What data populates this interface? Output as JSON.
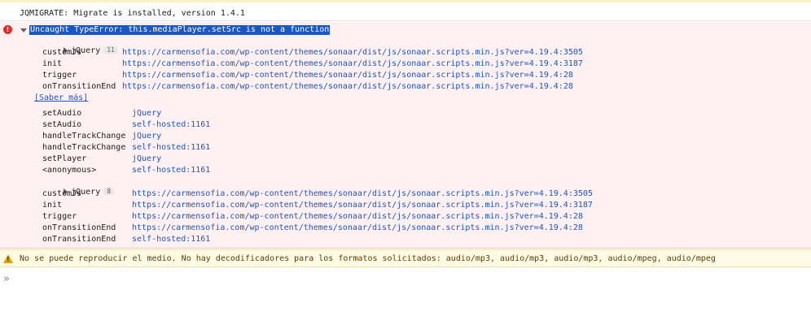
{
  "console": {
    "log_message": "JQMIGRATE: Migrate is installed, version 1.4.1",
    "error": {
      "icon": "error-circle-icon",
      "message": "Uncaught TypeError: this.mediaPlayer.setSrc is not a function",
      "group1": {
        "label": "jQuery",
        "count": "11"
      },
      "frames1": [
        {
          "fn": "customJs",
          "loc": "https://carmensofia.com/wp-content/themes/sonaar/dist/js/sonaar.scripts.min.js?ver=4.19.4:3505"
        },
        {
          "fn": "init",
          "loc": "https://carmensofia.com/wp-content/themes/sonaar/dist/js/sonaar.scripts.min.js?ver=4.19.4:3187"
        },
        {
          "fn": "trigger",
          "loc": "https://carmensofia.com/wp-content/themes/sonaar/dist/js/sonaar.scripts.min.js?ver=4.19.4:28"
        },
        {
          "fn": "onTransitionEnd",
          "loc": "https://carmensofia.com/wp-content/themes/sonaar/dist/js/sonaar.scripts.min.js?ver=4.19.4:28"
        }
      ],
      "learn_more": "[Saber más]",
      "frames2": [
        {
          "fn": "setAudio",
          "loc": "jQuery"
        },
        {
          "fn": "setAudio",
          "loc": "self-hosted:1161"
        },
        {
          "fn": "handleTrackChange",
          "loc": "jQuery"
        },
        {
          "fn": "handleTrackChange",
          "loc": "self-hosted:1161"
        },
        {
          "fn": "setPlayer",
          "loc": "jQuery"
        },
        {
          "fn": "<anonymous>",
          "loc": "self-hosted:1161"
        }
      ],
      "group2": {
        "label": "jQuery",
        "count": "8"
      },
      "frames3": [
        {
          "fn": "customJs",
          "loc": "https://carmensofia.com/wp-content/themes/sonaar/dist/js/sonaar.scripts.min.js?ver=4.19.4:3505"
        },
        {
          "fn": "init",
          "loc": "https://carmensofia.com/wp-content/themes/sonaar/dist/js/sonaar.scripts.min.js?ver=4.19.4:3187"
        },
        {
          "fn": "trigger",
          "loc": "https://carmensofia.com/wp-content/themes/sonaar/dist/js/sonaar.scripts.min.js?ver=4.19.4:28"
        },
        {
          "fn": "onTransitionEnd",
          "loc": "https://carmensofia.com/wp-content/themes/sonaar/dist/js/sonaar.scripts.min.js?ver=4.19.4:28"
        },
        {
          "fn": "onTransitionEnd",
          "loc": "self-hosted:1161"
        }
      ]
    },
    "warning": {
      "icon": "warning-triangle-icon",
      "message": "No se puede reproducir el medio. No hay decodificadores para los formatos solicitados: audio/mp3, audio/mp3, audio/mp3, audio/mpeg, audio/mpeg"
    },
    "prompt_glyph": "»"
  },
  "colors": {
    "error_bg": "#fff0f1",
    "warning_bg": "#fffbe5",
    "link": "#1a56c5",
    "selection": "#1a56c5"
  }
}
